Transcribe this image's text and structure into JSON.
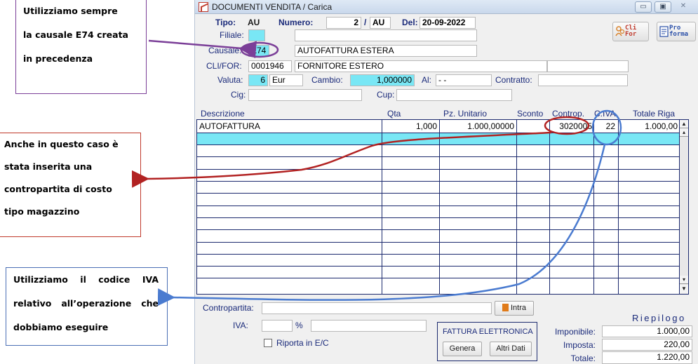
{
  "callouts": {
    "causale": [
      "Utilizziamo sempre",
      "la causale E74 creata",
      "in precedenza"
    ],
    "contropartita": [
      "Anche in questo caso è",
      "stata inserita una",
      "contropartita di costo",
      "tipo magazzino"
    ],
    "iva": [
      "Utilizziamo il codice IVA",
      "relativo all’operazione che",
      "dobbiamo eseguire"
    ]
  },
  "window": {
    "title": "DOCUMENTI VENDITA / Carica",
    "min_label": "▭",
    "max_label": "▣",
    "close_label": "✕"
  },
  "header": {
    "tipo_label": "Tipo:",
    "tipo_value": "AU",
    "numero_label": "Numero:",
    "numero_value": "2",
    "numero_sep": "/",
    "numero_suffix": "AU",
    "del_label": "Del:",
    "del_value": "20-09-2022",
    "filiale_label": "Filiale:",
    "filiale_value": "",
    "filiale_desc": "",
    "causale_label": "Causale:",
    "causale_value": "E74",
    "causale_desc": "AUTOFATTURA ESTERA",
    "clifor_label": "CLI/FOR:",
    "clifor_value": "0001946",
    "clifor_desc": "FORNITORE ESTERO",
    "valuta_label": "Valuta:",
    "valuta_code": "6",
    "valuta_value": "Eur",
    "cambio_label": "Cambio:",
    "cambio_value": "1,000000",
    "al_label": "Al:",
    "al_value": "- -",
    "contratto_label": "Contratto:",
    "contratto_value": "",
    "cig_label": "Cig:",
    "cig_value": "",
    "cup_label": "Cup:",
    "cup_value": ""
  },
  "toolbar": {
    "clifor_btn": "Cli For",
    "clifor_line1": "Cli",
    "clifor_line2": "For",
    "proforma_line1": "Pro",
    "proforma_line2": "forma"
  },
  "grid": {
    "columns": [
      "Descrizione",
      "Qta",
      "Pz. Unitario",
      "Sconto",
      "Controp.",
      "C.IVA",
      "Totale Riga"
    ],
    "rows": [
      {
        "descrizione": "AUTOFATTURA",
        "qta": "1,000",
        "pz_unitario": "1.000,00000",
        "sconto": "",
        "controp": "3020005",
        "civa": "22",
        "totale": "1.000,00"
      }
    ]
  },
  "footer": {
    "contropartita_label": "Contropartita:",
    "contropartita_value": "",
    "intra_label": "Intra",
    "iva_label": "IVA:",
    "iva_value": "",
    "iva_pct": "%",
    "iva_desc": "",
    "riporta_label": "Riporta in E/C",
    "fe_title": "FATTURA ELETTRONICA",
    "genera_label": "Genera",
    "altri_dati_label": "Altri Dati",
    "riepilogo_title": "Riepilogo",
    "imponibile_label": "Imponibile:",
    "imponibile_value": "1.000,00",
    "imposta_label": "Imposta:",
    "imposta_value": "220,00",
    "totale_label": "Totale:",
    "totale_value": "1.220,00"
  },
  "colors": {
    "highlight_cyan": "#79e7f5",
    "label_blue": "#1a2a7a",
    "annotation_purple": "#7b3f98",
    "annotation_red": "#b22222",
    "annotation_blue": "#4a7bd0"
  },
  "icons": [
    "app-icon",
    "minimize-icon",
    "maximize-icon",
    "close-icon",
    "clifor-icon",
    "proforma-icon",
    "scroll-up-icon",
    "scroll-down-icon",
    "intra-icon"
  ]
}
